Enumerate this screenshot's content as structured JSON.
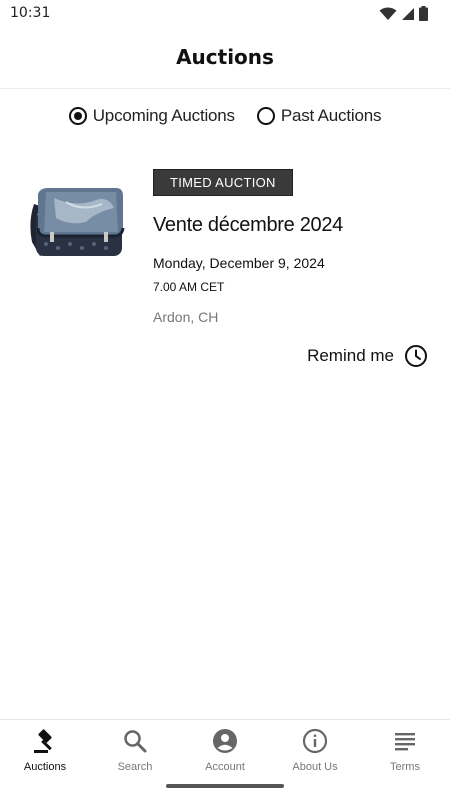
{
  "status_bar": {
    "time": "10:31",
    "icons": [
      "wifi-icon",
      "cell-signal-icon",
      "battery-icon"
    ]
  },
  "header": {
    "title": "Auctions"
  },
  "filter": {
    "options": [
      {
        "label": "Upcoming Auctions",
        "selected": true
      },
      {
        "label": "Past Auctions",
        "selected": false
      }
    ]
  },
  "auctions": [
    {
      "badge": "TIMED AUCTION",
      "name": "Vente décembre 2024",
      "date": "Monday, December 9, 2024",
      "time": "7.00 AM CET",
      "location": "Ardon, CH",
      "remind_label": "Remind me",
      "image_icon": "messenger-bag-image"
    }
  ],
  "bottom_nav": {
    "items": [
      {
        "label": "Auctions",
        "icon": "gavel-icon",
        "active": true
      },
      {
        "label": "Search",
        "icon": "search-icon",
        "active": false
      },
      {
        "label": "Account",
        "icon": "account-icon",
        "active": false
      },
      {
        "label": "About Us",
        "icon": "info-icon",
        "active": false
      },
      {
        "label": "Terms",
        "icon": "menu-lines-icon",
        "active": false
      }
    ]
  },
  "colors": {
    "badge_bg": "#3a3a3a",
    "text": "#111111",
    "muted": "#777777"
  }
}
